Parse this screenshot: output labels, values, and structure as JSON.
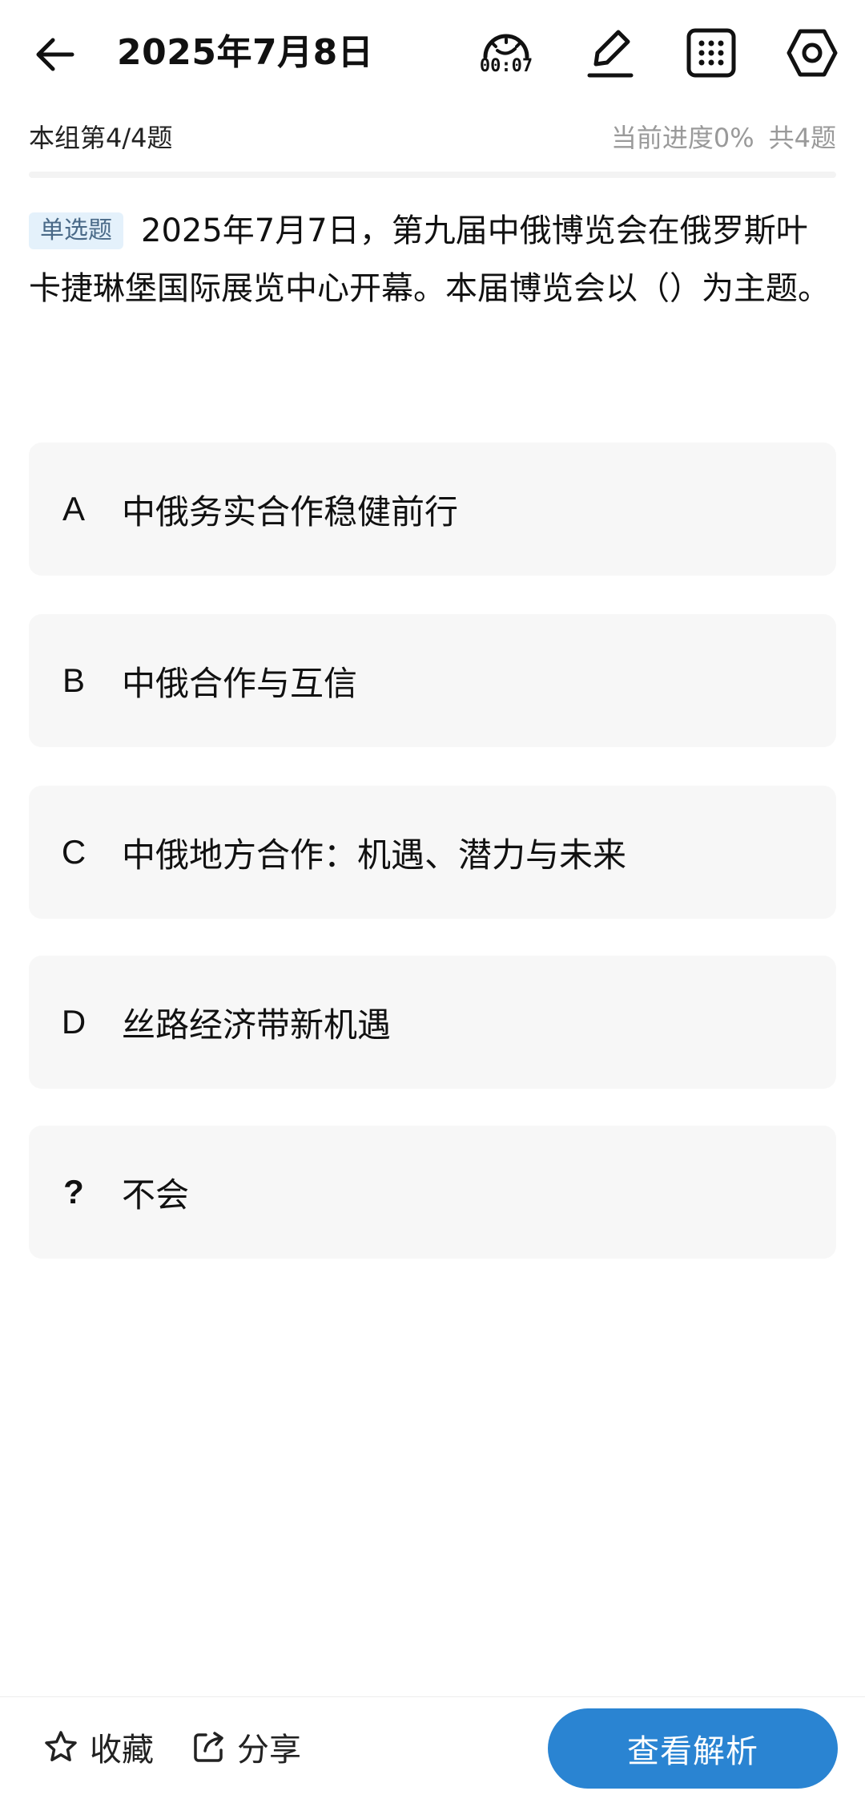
{
  "header": {
    "title": "2025年7月8日",
    "timer": "00:07",
    "icons": [
      "back-arrow-icon",
      "timer-icon",
      "edit-icon",
      "grid-icon",
      "settings-icon"
    ]
  },
  "progress": {
    "group_label": "本组第4/4题",
    "current_progress": "当前进度0%",
    "total": "共4题"
  },
  "question": {
    "type_badge": "单选题",
    "text": "2025年7月7日，第九届中俄博览会在俄罗斯叶卡捷琳堡国际展览中心开幕。本届博览会以（）为主题。"
  },
  "options": [
    {
      "letter": "A",
      "text": "中俄务实合作稳健前行"
    },
    {
      "letter": "B",
      "text": "中俄合作与互信"
    },
    {
      "letter": "C",
      "text": "中俄地方合作：机遇、潜力与未来"
    },
    {
      "letter": "D",
      "text": "丝路经济带新机遇"
    },
    {
      "letter": "?",
      "text": "不会"
    }
  ],
  "bottom_bar": {
    "favorite_label": "收藏",
    "share_label": "分享",
    "analysis_button": "查看解析"
  },
  "colors": {
    "accent": "#2a84d2",
    "badge_bg": "#e4f1fb",
    "option_bg": "#f7f7f7",
    "muted_text": "#9a9a9a"
  }
}
